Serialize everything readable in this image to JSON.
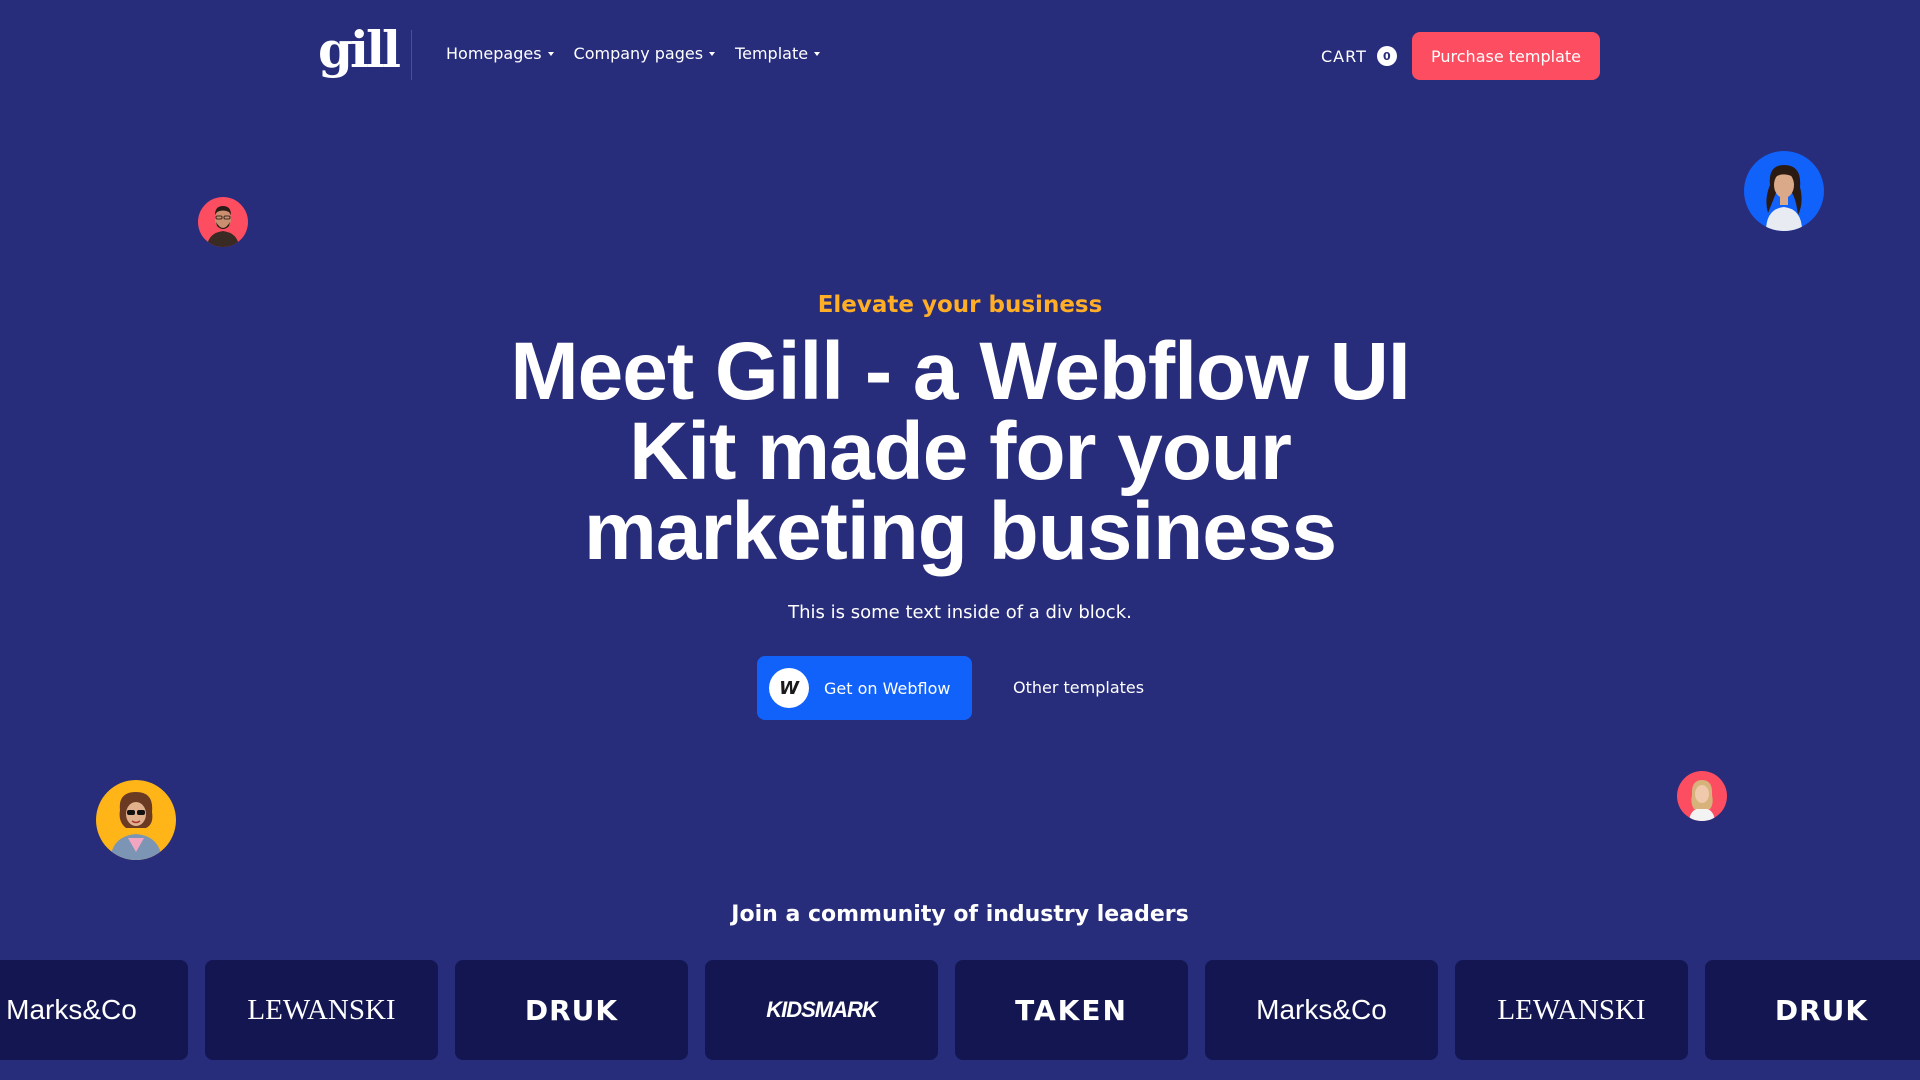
{
  "nav": {
    "logo_text": "gill",
    "links": [
      {
        "label": "Homepages"
      },
      {
        "label": "Company pages"
      },
      {
        "label": "Template"
      }
    ],
    "cart_label": "CART",
    "cart_count": "0",
    "purchase_label": "Purchase template"
  },
  "hero": {
    "eyebrow": "Elevate your business",
    "headline": "Meet Gill - a Webflow UI Kit made for your marketing business",
    "subtext": "This is some text inside of a div block.",
    "primary_cta": {
      "badge": "W",
      "label": "Get on Webflow"
    },
    "secondary_cta": "Other templates"
  },
  "avatars": [
    {
      "name": "man-with-beard",
      "bg": "#fd4d61"
    },
    {
      "name": "woman-dark-hair",
      "bg": "#1162fb"
    },
    {
      "name": "woman-sunglasses",
      "bg": "#ffb517"
    },
    {
      "name": "woman-blonde",
      "bg": "#fd4d61"
    }
  ],
  "community": {
    "title": "Join a community of industry leaders",
    "logos": [
      "Marks&Co",
      "LEWANSKI",
      "DRUK",
      "KIDSMARK",
      "TAKEN",
      "Marks&Co",
      "LEWANSKI",
      "DRUK"
    ]
  },
  "colors": {
    "background": "#272c7b",
    "accent_orange": "#ffae26",
    "accent_red": "#fd4d61",
    "primary_blue": "#1162fb",
    "logo_card": "#131650"
  }
}
